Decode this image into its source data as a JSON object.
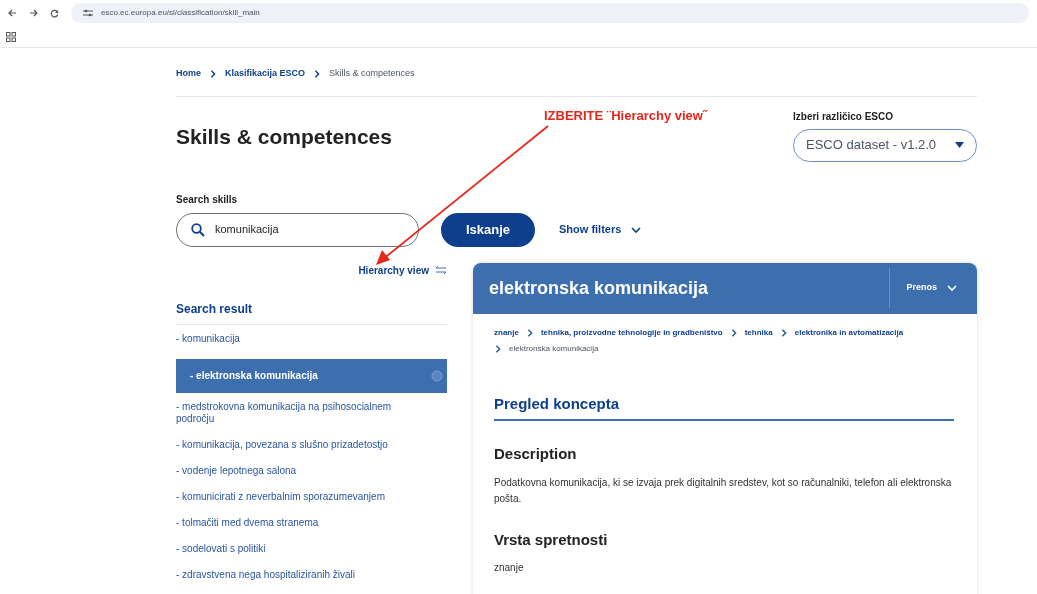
{
  "browser": {
    "url": "esco.ec.europa.eu/sl/classification/skill_main"
  },
  "breadcrumbs": [
    {
      "label": "Home",
      "link": true
    },
    {
      "label": "Klasifikacija ESCO",
      "link": true
    },
    {
      "label": "Skills & competences",
      "link": false
    }
  ],
  "page_title": "Skills & competences",
  "annotation": {
    "text": "IZBERITE ¨Hierarchy view˝"
  },
  "version": {
    "label": "Izberi različico ESCO",
    "value": "ESCO dataset - v1.2.0"
  },
  "search": {
    "label": "Search skills",
    "value": "komunikacija",
    "button": "Iskanje",
    "filters": "Show filters"
  },
  "hierarchy_link": "Hierarchy view",
  "results": {
    "title": "Search result",
    "items": [
      {
        "label": "- komunikacija",
        "selected": false
      },
      {
        "label": "- elektronska komunikacija",
        "selected": true
      },
      {
        "label": "- medstrokovna komunikacija na psihosocialnem področju",
        "selected": false
      },
      {
        "label": "- komunikacija, povezana s slušno prizadetostjo",
        "selected": false
      },
      {
        "label": "- vodenje lepotnega salona",
        "selected": false
      },
      {
        "label": "- komunicirati z neverbalnim sporazumevanjem",
        "selected": false
      },
      {
        "label": "- tolmačiti med dvema stranema",
        "selected": false
      },
      {
        "label": "- sodelovati s politiki",
        "selected": false
      },
      {
        "label": "- zdravstvena nega hospitaliziranih živali",
        "selected": false
      }
    ]
  },
  "detail": {
    "title": "elektronska komunikacija",
    "download": "Prenos",
    "path": [
      {
        "label": "znanje",
        "link": true
      },
      {
        "label": "tehnika, proizvodne tehnologije in gradbeništvo",
        "link": true
      },
      {
        "label": "tehnika",
        "link": true
      },
      {
        "label": "elektronika in avtomatizacija",
        "link": true
      },
      {
        "label": "elektronska komunikacija",
        "link": false
      }
    ],
    "overview": "Pregled koncepta",
    "sections": [
      {
        "heading": "Description",
        "text": "Podatkovna komunikacija, ki se izvaja prek digitalnih sredstev, kot so računalniki, telefon ali elektronska pošta."
      },
      {
        "heading": "Vrsta spretnosti",
        "text": "znanje"
      }
    ]
  }
}
